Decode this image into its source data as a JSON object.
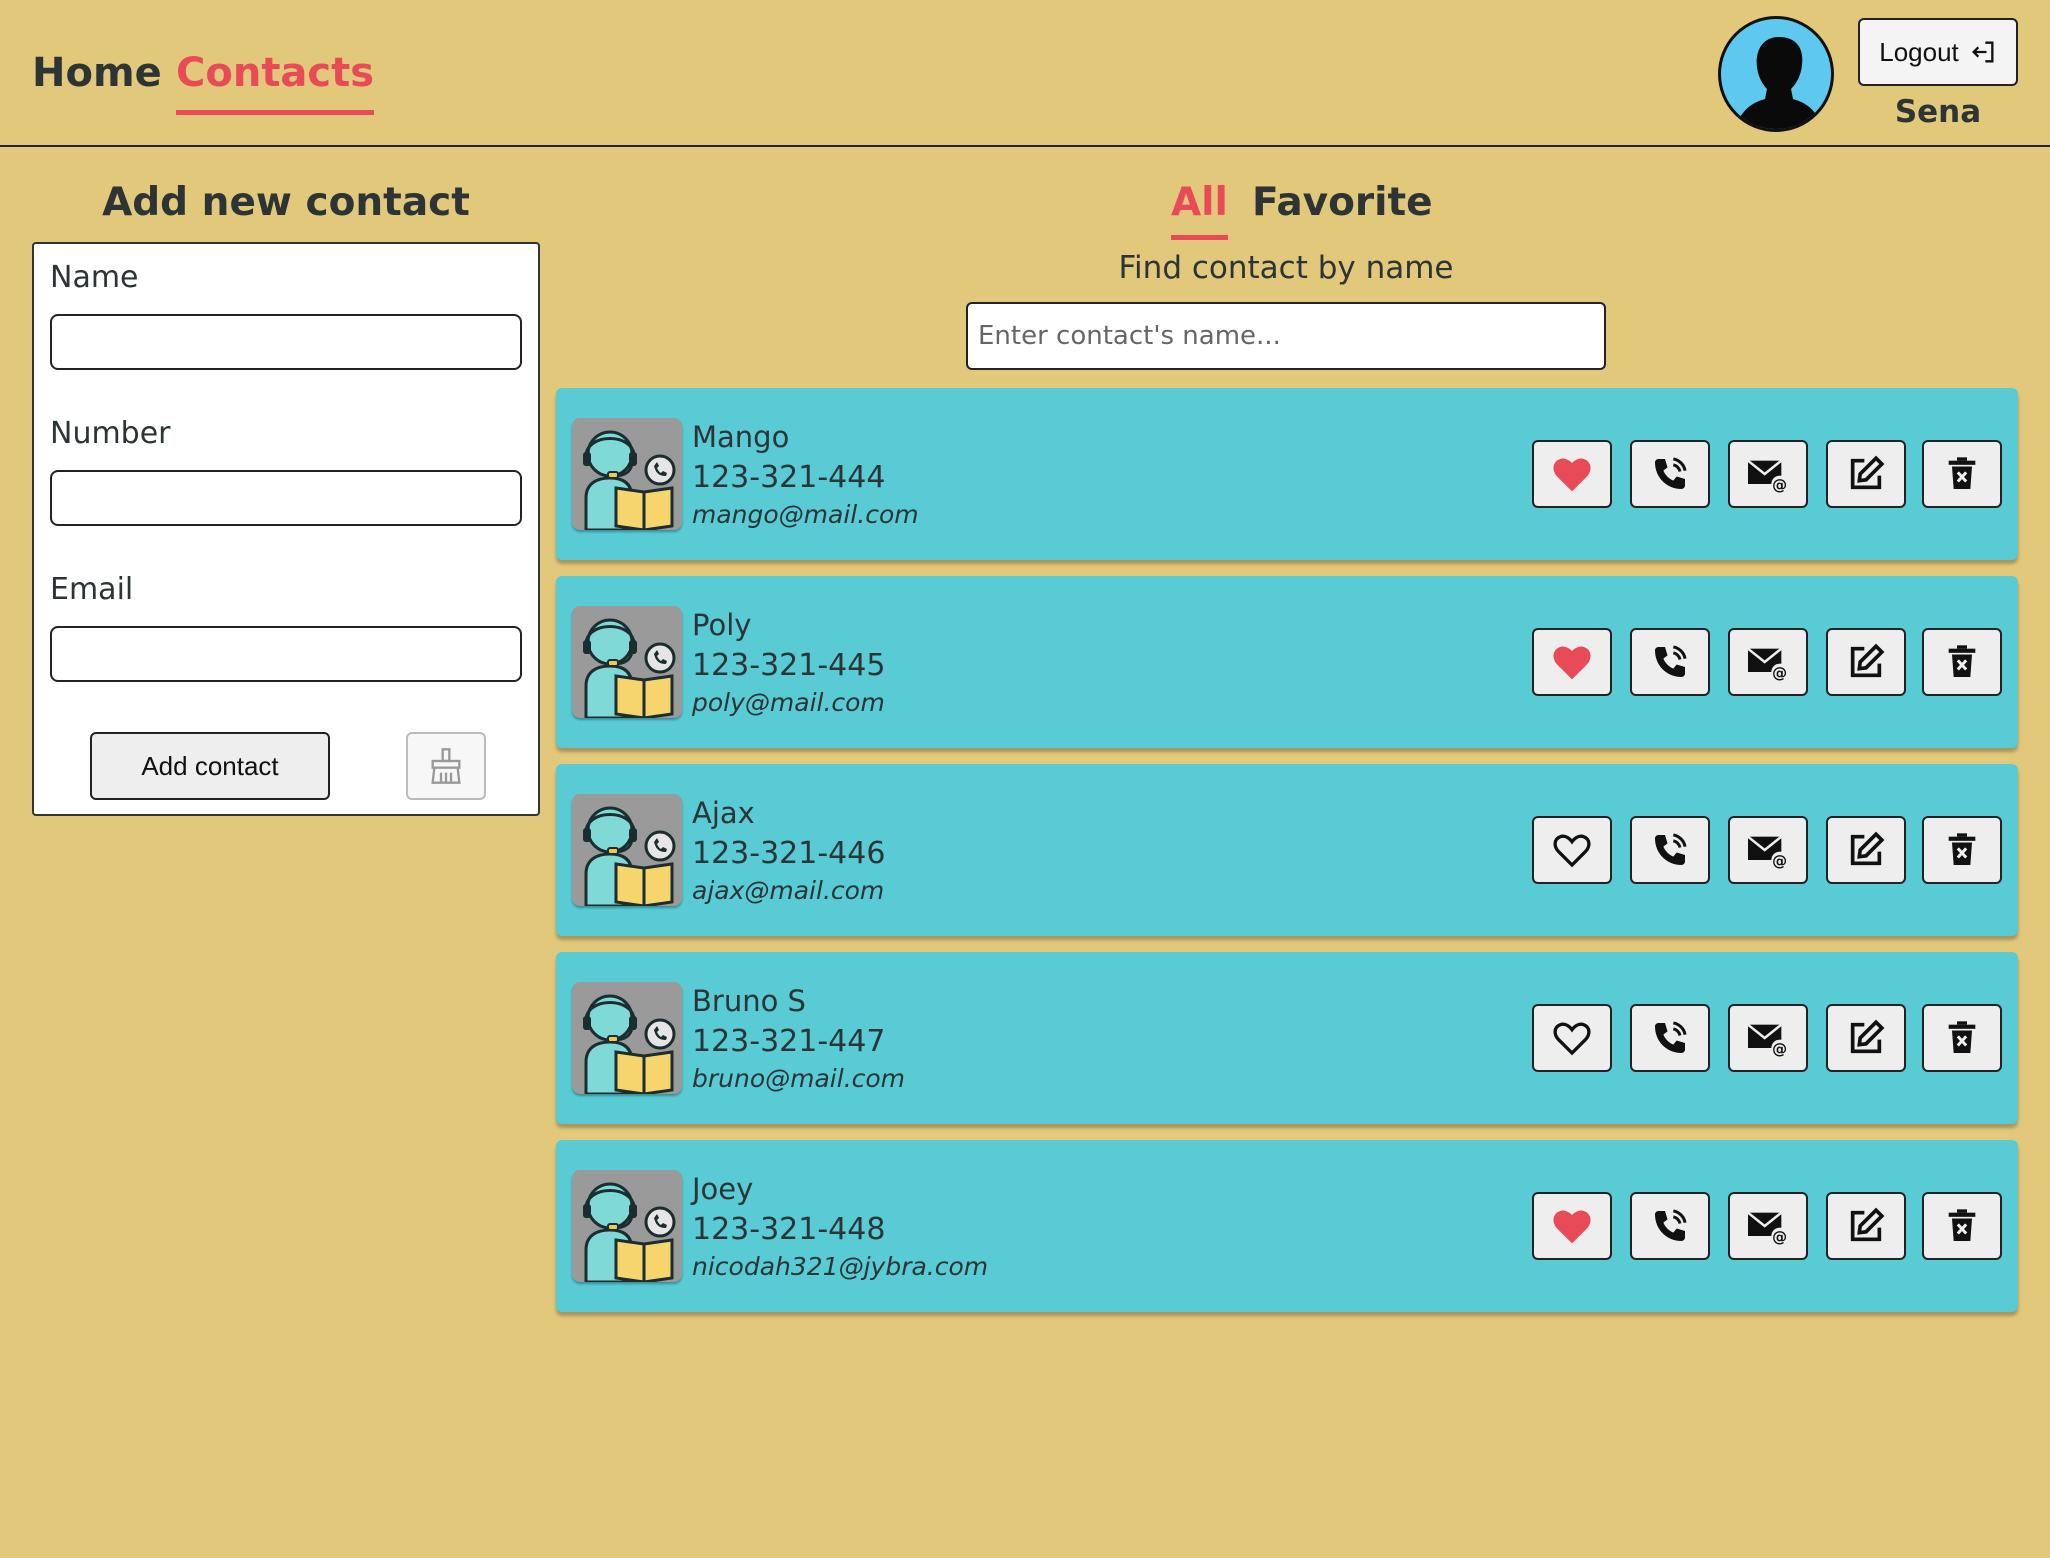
{
  "nav": {
    "home": "Home",
    "contacts": "Contacts"
  },
  "user": {
    "name": "Sena",
    "logout": "Logout"
  },
  "form": {
    "title": "Add new contact",
    "name_label": "Name",
    "number_label": "Number",
    "email_label": "Email",
    "submit": "Add contact"
  },
  "filters": {
    "all": "All",
    "favorite": "Favorite",
    "active": "All"
  },
  "search": {
    "label": "Find contact by name",
    "placeholder": "Enter contact's name..."
  },
  "contacts": [
    {
      "name": "Mango",
      "number": "123-321-444",
      "email": "mango@mail.com",
      "favorite": true
    },
    {
      "name": "Poly",
      "number": "123-321-445",
      "email": "poly@mail.com",
      "favorite": true
    },
    {
      "name": "Ajax",
      "number": "123-321-446",
      "email": "ajax@mail.com",
      "favorite": false
    },
    {
      "name": "Bruno S",
      "number": "123-321-447",
      "email": "bruno@mail.com",
      "favorite": false
    },
    {
      "name": "Joey",
      "number": "123-321-448",
      "email": "nicodah321@jybra.com",
      "favorite": true
    }
  ],
  "colors": {
    "background": "#e1c87b",
    "accent": "#e84b57",
    "card": "#58cbd5",
    "favorite": "#e84b57"
  },
  "icons": {
    "logout": "logout-icon",
    "clear": "broom-icon",
    "favorite": "heart-icon",
    "call": "phone-icon",
    "email": "envelope-at-icon",
    "edit": "edit-icon",
    "delete": "trash-icon"
  }
}
